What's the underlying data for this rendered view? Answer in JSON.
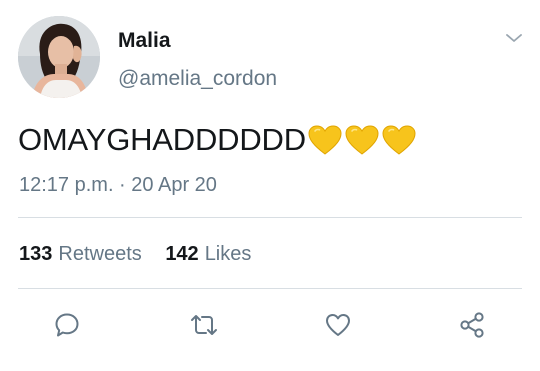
{
  "user": {
    "display_name": "Malia",
    "handle": "@amelia_cordon"
  },
  "tweet": {
    "text": "OMAYGHADDDDDD",
    "emojis": [
      "yellow-heart",
      "yellow-heart",
      "yellow-heart"
    ],
    "timestamp": "12:17 p.m. · 20 Apr 20"
  },
  "stats": {
    "retweets_count": "133",
    "retweets_label": "Retweets",
    "likes_count": "142",
    "likes_label": "Likes"
  },
  "actions": [
    "reply-icon",
    "retweet-icon",
    "like-icon",
    "share-icon"
  ],
  "icons": {
    "menu": "chevron-down-icon"
  },
  "colors": {
    "text_primary": "#14171a",
    "text_secondary": "#657786",
    "icon": "#657786",
    "divider": "#d8dee3",
    "heart_emoji": "#f5c518"
  }
}
